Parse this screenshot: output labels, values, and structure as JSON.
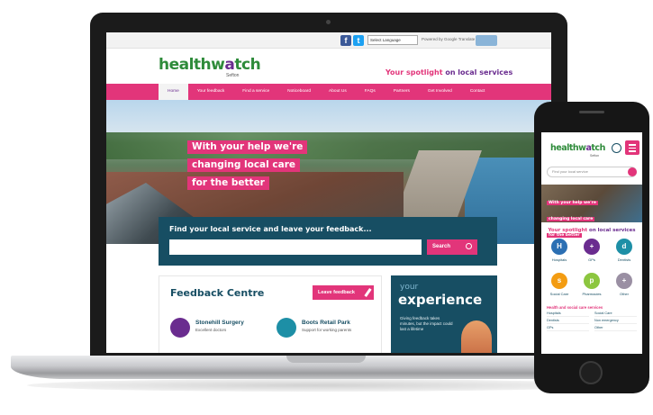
{
  "brand": {
    "logo_main": "healthw",
    "logo_w": "a",
    "logo_end": "tch",
    "logo_sub": "Sefton",
    "tagline_prefix": "Your spotlight",
    "tagline_suffix": " on local services"
  },
  "colors": {
    "pink": "#e2357a",
    "navy": "#174e63",
    "green": "#2e8b3a",
    "purple": "#6a2c8f"
  },
  "topbar": {
    "social_facebook": "f",
    "social_twitter": "t",
    "language_select": "Select Language",
    "powered_by": "Powered by Google Translate",
    "icons": [
      "facebook-icon",
      "twitter-icon",
      "translate-icon"
    ]
  },
  "nav": [
    "Home",
    "Your feedback",
    "Find a service",
    "Noticeboard",
    "About Us",
    "FAQs",
    "Partners",
    "Get Involved",
    "Contact"
  ],
  "hero": {
    "headline_lines": [
      "With your help we're",
      "changing local care",
      "for the better"
    ]
  },
  "search": {
    "title": "Find your local service and leave your feedback...",
    "button": "Search"
  },
  "feedback": {
    "title": "Feedback Centre",
    "leave_button": "Leave feedback",
    "items": [
      {
        "name": "Stonehill Surgery",
        "desc": "Excellent doctors"
      },
      {
        "name": "Boots Retail Park",
        "desc": "Support for working parents"
      }
    ]
  },
  "experience": {
    "small": "your",
    "big": "experience",
    "text": "Giving feedback takes minutes, but the impact could last a lifetime"
  },
  "phone": {
    "search_placeholder": "Find your local service",
    "hero_lines": [
      "With your help we're",
      "changing local care",
      "for the better"
    ],
    "services": [
      "Hospitals",
      "GPs",
      "Dentists",
      "Social Care",
      "Pharmacies",
      "Other"
    ],
    "list_title": "Health and social care services",
    "list": [
      "Hospitals",
      "Social Care",
      "Dentists",
      "Non emergency",
      "GPs",
      "Other"
    ]
  }
}
